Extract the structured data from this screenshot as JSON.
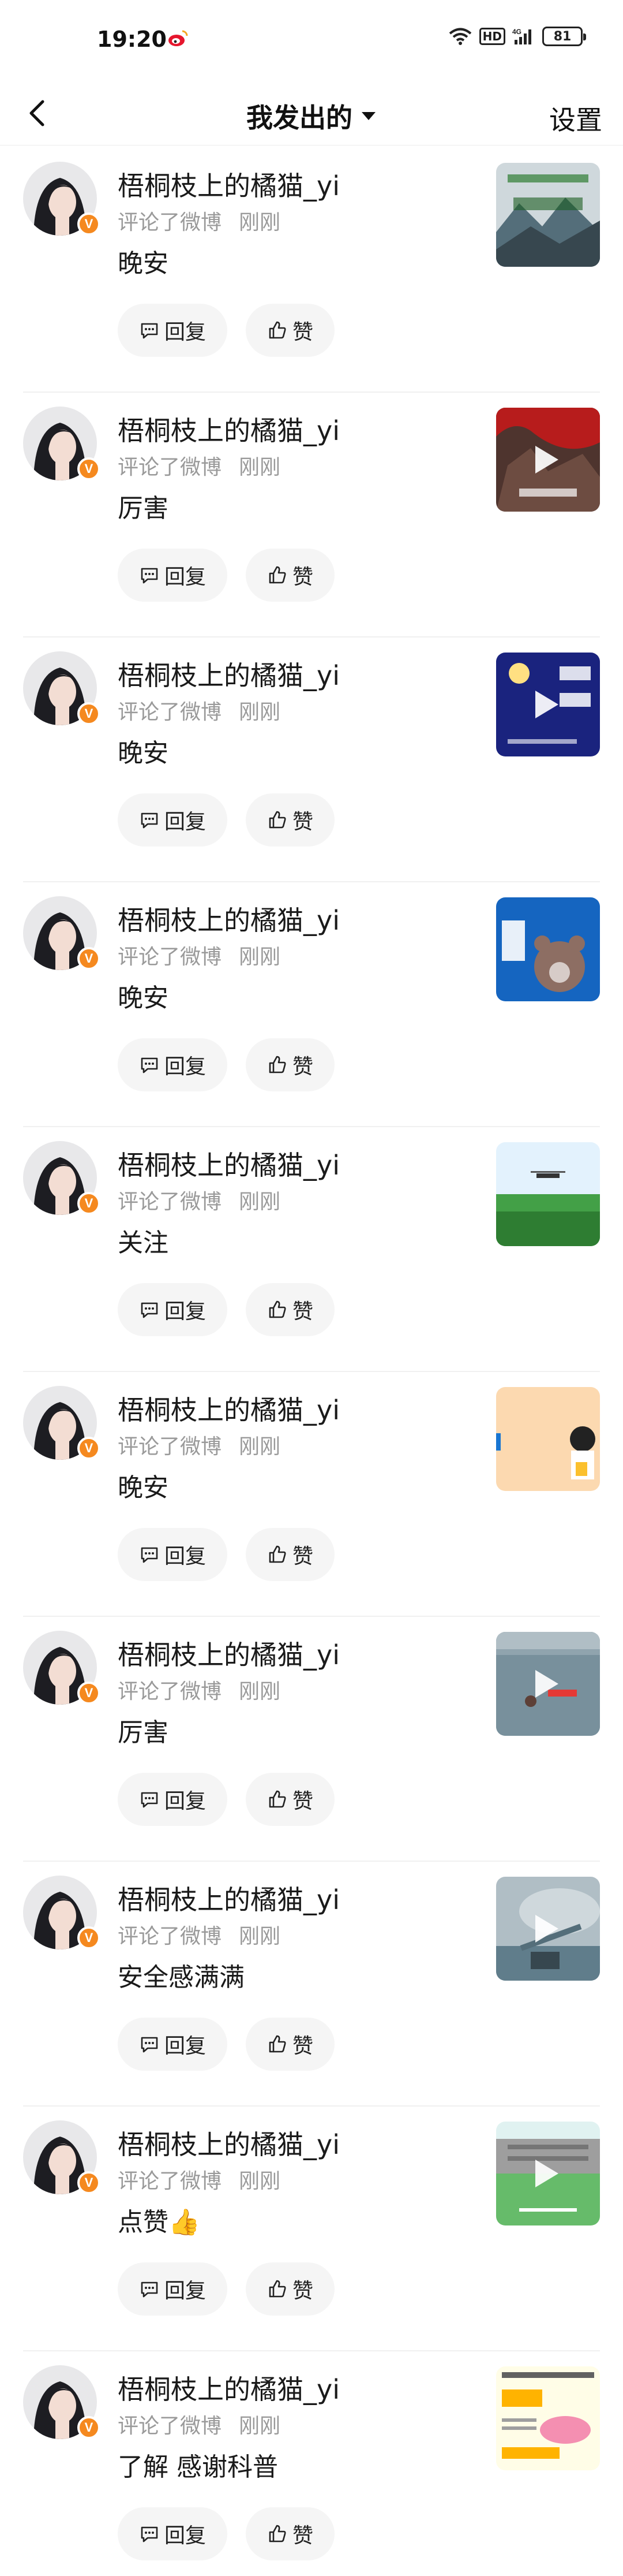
{
  "status_bar": {
    "time": "19:20",
    "network": "4G",
    "hd": "HD",
    "battery": "81"
  },
  "nav": {
    "title": "我发出的",
    "settings": "设置"
  },
  "labels": {
    "reply": "回复",
    "like": "赞"
  },
  "comments": [
    {
      "username": "梧桐枝上的橘猫_yi",
      "action": "评论了微博",
      "time": "刚刚",
      "text": "晚安",
      "thumb": "mountain-mist",
      "video": false
    },
    {
      "username": "梧桐枝上的橘猫_yi",
      "action": "评论了微博",
      "time": "刚刚",
      "text": "厉害",
      "thumb": "red-canyon",
      "video": true
    },
    {
      "username": "梧桐枝上的橘猫_yi",
      "action": "评论了微博",
      "time": "刚刚",
      "text": "晚安",
      "thumb": "goodnight-world",
      "video": true
    },
    {
      "username": "梧桐枝上的橘猫_yi",
      "action": "评论了微博",
      "time": "刚刚",
      "text": "晚安",
      "thumb": "bear-card",
      "video": false
    },
    {
      "username": "梧桐枝上的橘猫_yi",
      "action": "评论了微博",
      "time": "刚刚",
      "text": "关注",
      "thumb": "green-field-drone",
      "video": false
    },
    {
      "username": "梧桐枝上的橘猫_yi",
      "action": "评论了微博",
      "time": "刚刚",
      "text": "晚安",
      "thumb": "peach-illustration",
      "video": false
    },
    {
      "username": "梧桐枝上的橘猫_yi",
      "action": "评论了微博",
      "time": "刚刚",
      "text": "厉害",
      "thumb": "water-rescue",
      "video": true
    },
    {
      "username": "梧桐枝上的橘猫_yi",
      "action": "评论了微博",
      "time": "刚刚",
      "text": "安全感满满",
      "thumb": "smoke-field",
      "video": true
    },
    {
      "username": "梧桐枝上的橘猫_yi",
      "action": "评论了微博",
      "time": "刚刚",
      "text": "点赞👍",
      "thumb": "campus-lawn",
      "video": true
    },
    {
      "username": "梧桐枝上的橘猫_yi",
      "action": "评论了微博",
      "time": "刚刚",
      "text": "了解 感谢科普",
      "thumb": "science-poster",
      "video": false
    }
  ],
  "icons": {
    "back": "chevron-left-icon",
    "dropdown": "triangle-down-icon",
    "reply": "comment-icon",
    "like": "thumbs-up-icon",
    "verified": "v-badge-icon"
  },
  "colors": {
    "verified_badge": "#f5891f",
    "meta_text": "#9a9a9a",
    "pill_bg": "#f5f5f5"
  }
}
